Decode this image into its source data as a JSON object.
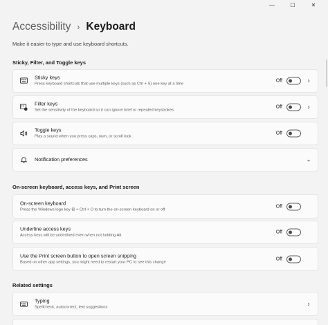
{
  "window": {
    "minimize": "—",
    "maximize": "☐",
    "close": "✕"
  },
  "breadcrumb": {
    "parent": "Accessibility",
    "separator": "›",
    "current": "Keyboard"
  },
  "subtitle": "Make it easier to type and use keyboard shortcuts.",
  "sections": {
    "sticky_filter_toggle": "Sticky, Filter, and Toggle keys",
    "onscreen": "On-screen keyboard, access keys, and Print screen",
    "related": "Related settings"
  },
  "settings": {
    "sticky_keys": {
      "title": "Sticky keys",
      "desc": "Press keyboard shortcuts that use multiple keys (such as Ctrl + S) one key at a time",
      "state": "Off",
      "icon": "sticky-keys-icon"
    },
    "filter_keys": {
      "title": "Filter keys",
      "desc": "Set the sensitivity of the keyboard so it can ignore brief or repeated keystrokes",
      "state": "Off",
      "icon": "filter-keys-icon"
    },
    "toggle_keys": {
      "title": "Toggle keys",
      "desc": "Play a sound when you press caps, num, or scroll lock",
      "state": "Off",
      "icon": "speaker-icon"
    },
    "notification_preferences": {
      "title": "Notification preferences",
      "icon": "bell-icon"
    },
    "onscreen_keyboard": {
      "title": "On-screen keyboard",
      "desc": "Press the Windows logo key ⊞ + Ctrl + O to turn the on-screen keyboard on or off",
      "state": "Off"
    },
    "underline_access_keys": {
      "title": "Underline access keys",
      "desc": "Access keys will be underlined even when not holding Alt",
      "state": "Off"
    },
    "print_screen": {
      "title": "Use the Print screen button to open screen snipping",
      "desc": "Based on other app settings, you might need to restart your PC to see this change",
      "state": "Off"
    },
    "typing": {
      "title": "Typing",
      "desc": "Spellcheck, autocorrect, text suggestions",
      "icon": "keyboard-icon"
    }
  },
  "chevrons": {
    "right": "›",
    "down": "⌄"
  }
}
